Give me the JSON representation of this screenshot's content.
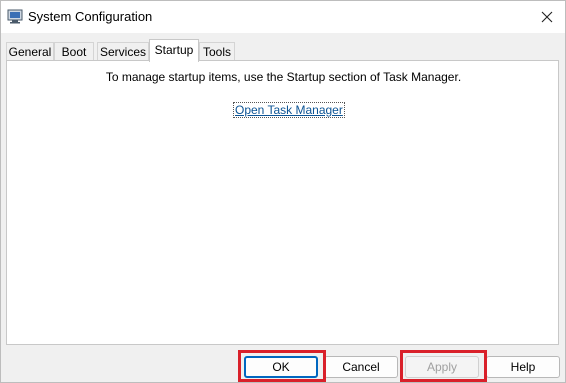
{
  "window": {
    "title": "System Configuration",
    "app_icon": "system-configuration-icon",
    "close_icon": "close-icon"
  },
  "tabs": [
    {
      "label": "General",
      "active": false
    },
    {
      "label": "Boot",
      "active": false
    },
    {
      "label": "Services",
      "active": false
    },
    {
      "label": "Startup",
      "active": true
    },
    {
      "label": "Tools",
      "active": false
    }
  ],
  "startup": {
    "message": "To manage startup items, use the Startup section of Task Manager.",
    "link_label": "Open Task Manager"
  },
  "buttons": {
    "ok": "OK",
    "cancel": "Cancel",
    "apply": "Apply",
    "help": "Help"
  },
  "colors": {
    "highlight": "#d9202a",
    "link": "#0b5394",
    "accent": "#0067c0"
  }
}
